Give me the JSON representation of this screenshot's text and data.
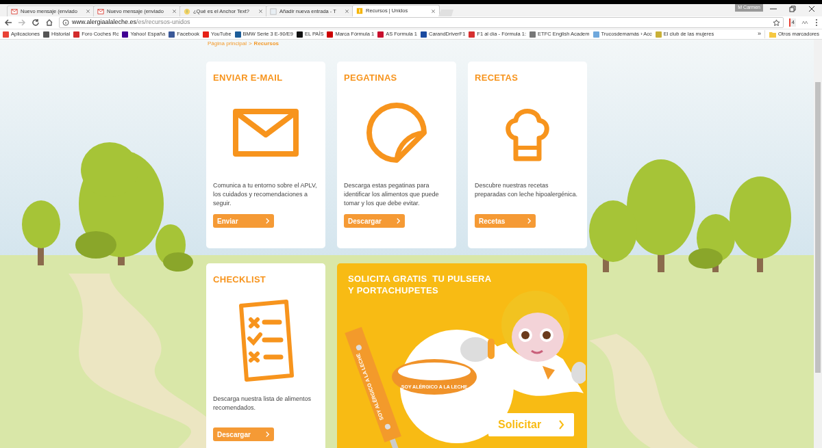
{
  "browser": {
    "tabs": [
      {
        "title": "Nuevo mensaje (enviado",
        "kind": "mail",
        "selected": false
      },
      {
        "title": "Nuevo mensaje (enviado",
        "kind": "mail",
        "selected": false
      },
      {
        "title": "¿Qué es el Anchor Text?",
        "kind": "bulb",
        "selected": false
      },
      {
        "title": "Añadir nueva entrada - T",
        "kind": "page",
        "selected": false
      },
      {
        "title": "Recursos | Unidos",
        "kind": "site",
        "selected": true
      }
    ],
    "profile": "M Carmen",
    "url": {
      "domain": "www.alergiaalaleche.es",
      "path": "/es/recursos-unidos"
    },
    "extension_badge": "4",
    "bookmarks": [
      {
        "title": "Aplicaciones",
        "color": "#e94235"
      },
      {
        "title": "Historial",
        "color": "#555555"
      },
      {
        "title": "Foro Coches Rc",
        "color": "#d22b2b"
      },
      {
        "title": "Yahoo! España",
        "color": "#410093"
      },
      {
        "title": "Facebook",
        "color": "#3b5998"
      },
      {
        "title": "YouTube",
        "color": "#e62117"
      },
      {
        "title": "BMW Serie 3 E-90/E9",
        "color": "#1c5d99"
      },
      {
        "title": "EL PAÍS",
        "color": "#111111"
      },
      {
        "title": "Marca Fórmula 1",
        "color": "#cc0000"
      },
      {
        "title": "AS Formula 1",
        "color": "#c8102e"
      },
      {
        "title": "CarandDriverF1",
        "color": "#1a4aa0"
      },
      {
        "title": "F1 al día - Fórmula 1:",
        "color": "#d62f2f"
      },
      {
        "title": "ETFC English Academ",
        "color": "#777777"
      },
      {
        "title": "Trucosdemamás › Acc",
        "color": "#6fa8dc"
      },
      {
        "title": "El club de las mujeres",
        "color": "#c9b037"
      }
    ],
    "more_bookmarks": "»",
    "other_bookmarks": "Otros marcadores"
  },
  "breadcrumb": {
    "items": [
      "Página principal",
      "Recursos"
    ],
    "separator": ">"
  },
  "cards": [
    {
      "kind": "email",
      "title": "ENVIAR E-MAIL",
      "description": "Comunica a tu entorno sobre el APLV, los cuidados y recomendaciones a seguir.",
      "button": "Enviar"
    },
    {
      "kind": "sticker",
      "title": "PEGATINAS",
      "description": "Descarga estas pegatinas para identificar los alimentos que puede tomar y los que debe evitar.",
      "button": "Descargar"
    },
    {
      "kind": "chef",
      "title": "RECETAS",
      "description": "Descubre nuestras recetas preparadas con leche hipoalergénica.",
      "button": "Recetas"
    },
    {
      "kind": "checklist",
      "title": "CHECKLIST",
      "description": "Descarga nuestra lista de alimentos recomendados.",
      "button": "Descargar"
    }
  ],
  "promo": {
    "title_lines": [
      "SOLICITA GRATIS  TU PULSERA",
      "Y PORTACHUPETES"
    ],
    "strap_text": "SOY ALÉRGICO A LA LECHE",
    "bracelet_text": "SOY ALÉRGICO A LA LECHE",
    "button": "Solicitar"
  }
}
